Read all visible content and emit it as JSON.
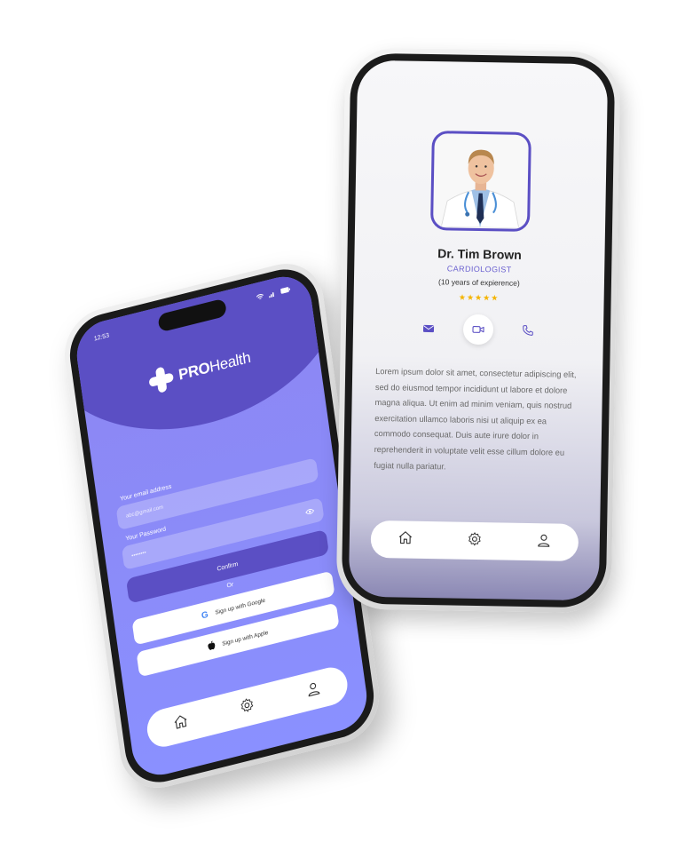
{
  "login_screen": {
    "status_time": "12:53",
    "brand": {
      "bold": "PRO",
      "light": "Health"
    },
    "email_label": "Your email address",
    "email_placeholder": "abc@gmail.com",
    "password_label": "Your Password",
    "password_value": "••••••••",
    "confirm_label": "Confirm",
    "or_label": "Or",
    "google_label": "Sign up with Google",
    "apple_label": "Sign up with Apple",
    "nav_icons": [
      "home-icon",
      "gear-icon",
      "user-icon"
    ]
  },
  "profile_screen": {
    "doctor_name": "Dr. Tim Brown",
    "specialty": "CARDIOLOGIST",
    "experience": "(10 years of expierence)",
    "rating": {
      "value": 5,
      "max": 5
    },
    "stars": "★★★★★",
    "action_icons": [
      "mail-icon",
      "video-icon",
      "phone-icon"
    ],
    "active_action": "video-icon",
    "description": "Lorem ipsum dolor sit amet, consectetur adipiscing elit, sed do eiusmod tempor incididunt ut labore et dolore magna aliqua. Ut enim ad minim veniam, quis nostrud exercitation ullamco laboris nisi ut aliquip ex ea commodo consequat. Duis aute irure dolor in reprehenderit in voluptate velit esse cillum dolore eu fugiat nulla pariatur.",
    "nav_icons": [
      "home-icon",
      "gear-icon",
      "user-icon"
    ]
  },
  "colors": {
    "brand_purple": "#5b4fc4",
    "screen_lilac": "#8a90ff",
    "star_gold": "#f4b400"
  }
}
